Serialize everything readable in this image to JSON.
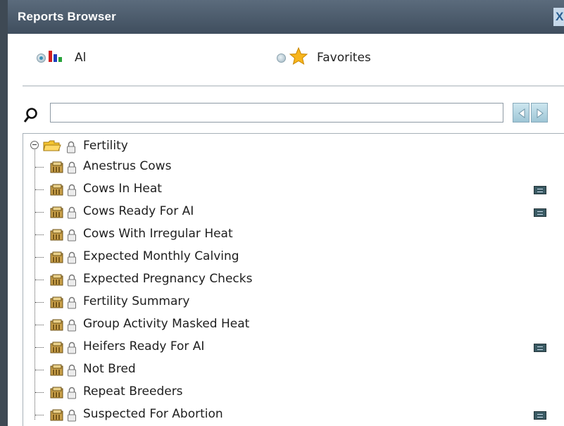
{
  "window": {
    "title": "Reports Browser",
    "close_label": "X"
  },
  "filters": {
    "all_label": "Al",
    "favorites_label": "Favorites",
    "selected": "all"
  },
  "search": {
    "value": "",
    "placeholder": ""
  },
  "tree": {
    "root_label": "Fertility",
    "items": [
      {
        "label": "Anestrus Cows",
        "has_badge": false
      },
      {
        "label": "Cows In Heat",
        "has_badge": true
      },
      {
        "label": "Cows Ready For AI",
        "has_badge": true
      },
      {
        "label": "Cows With Irregular Heat",
        "has_badge": false
      },
      {
        "label": "Expected Monthly Calving",
        "has_badge": false
      },
      {
        "label": "Expected Pregnancy Checks",
        "has_badge": false
      },
      {
        "label": "Fertility Summary",
        "has_badge": false
      },
      {
        "label": "Group Activity Masked Heat",
        "has_badge": false
      },
      {
        "label": "Heifers Ready For AI",
        "has_badge": true
      },
      {
        "label": "Not Bred",
        "has_badge": false
      },
      {
        "label": "Repeat Breeders",
        "has_badge": false
      },
      {
        "label": "Suspected For Abortion",
        "has_badge": true
      }
    ]
  },
  "colors": {
    "titlebar": "#4d5d6e",
    "accent": "#3b8fb5"
  }
}
